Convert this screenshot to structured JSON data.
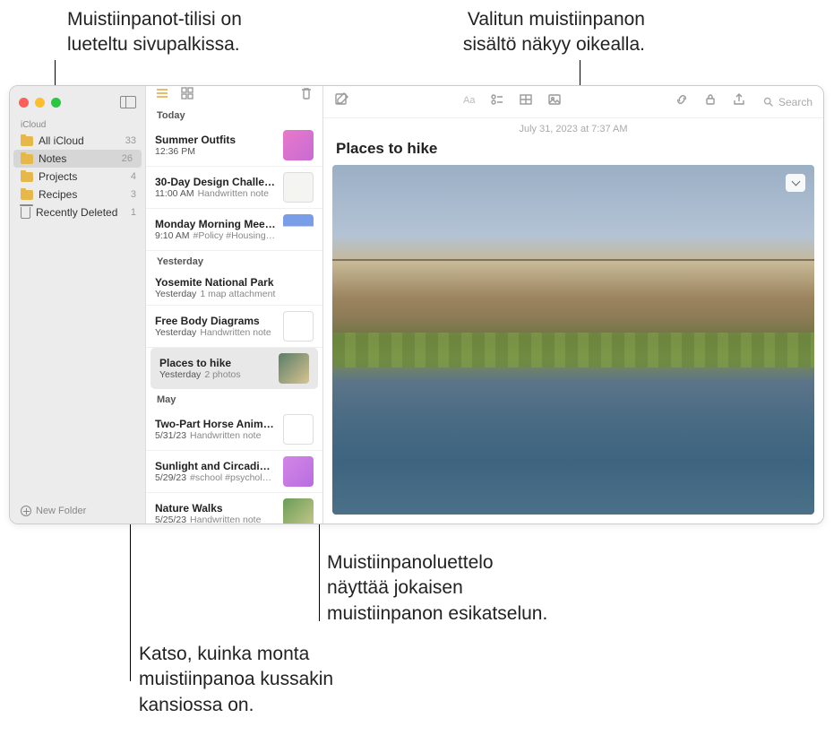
{
  "callouts": {
    "top_left": "Muistiinpanot-tilisi on\nlueteltu sivupalkissa.",
    "top_right": "Valitun muistiinpanon\nsisältö näkyy oikealla.",
    "bottom_right": "Muistiinpanoluettelo\nnäyttää jokaisen\nmuistiinpanon esikatselun.",
    "bottom_left": "Katso, kuinka monta\nmuistiinpanoa kussakin\nkansiossa on."
  },
  "sidebar": {
    "section": "iCloud",
    "items": [
      {
        "label": "All iCloud",
        "count": "33"
      },
      {
        "label": "Notes",
        "count": "26"
      },
      {
        "label": "Projects",
        "count": "4"
      },
      {
        "label": "Recipes",
        "count": "3"
      },
      {
        "label": "Recently Deleted",
        "count": "1"
      }
    ],
    "new_folder": "New Folder"
  },
  "notelist": {
    "groups": [
      {
        "label": "Today",
        "notes": [
          {
            "title": "Summer Outfits",
            "time": "12:36 PM",
            "sub": "",
            "thumb": "thumb-pink"
          },
          {
            "title": "30-Day Design Challen…",
            "time": "11:00 AM",
            "sub": "Handwritten note",
            "thumb": "thumb-doc"
          },
          {
            "title": "Monday Morning Meeting",
            "time": "9:10 AM",
            "sub": "#Policy #Housing…",
            "thumb": "thumb-blue"
          }
        ]
      },
      {
        "label": "Yesterday",
        "notes": [
          {
            "title": "Yosemite National Park",
            "time": "Yesterday",
            "sub": "1 map attachment",
            "thumb": ""
          },
          {
            "title": "Free Body Diagrams",
            "time": "Yesterday",
            "sub": "Handwritten note",
            "thumb": "thumb-diag"
          },
          {
            "title": "Places to hike",
            "time": "Yesterday",
            "sub": "2 photos",
            "thumb": "thumb-photo"
          }
        ]
      },
      {
        "label": "May",
        "notes": [
          {
            "title": "Two-Part Horse Anima…",
            "time": "5/31/23",
            "sub": "Handwritten note",
            "thumb": "thumb-horse"
          },
          {
            "title": "Sunlight and Circadian…",
            "time": "5/29/23",
            "sub": "#school #psycholo…",
            "thumb": "thumb-purple"
          },
          {
            "title": "Nature Walks",
            "time": "5/25/23",
            "sub": "Handwritten note",
            "thumb": "thumb-nature"
          }
        ]
      }
    ]
  },
  "content": {
    "date": "July 31, 2023 at 7:37 AM",
    "title": "Places to hike",
    "search_placeholder": "Search"
  }
}
